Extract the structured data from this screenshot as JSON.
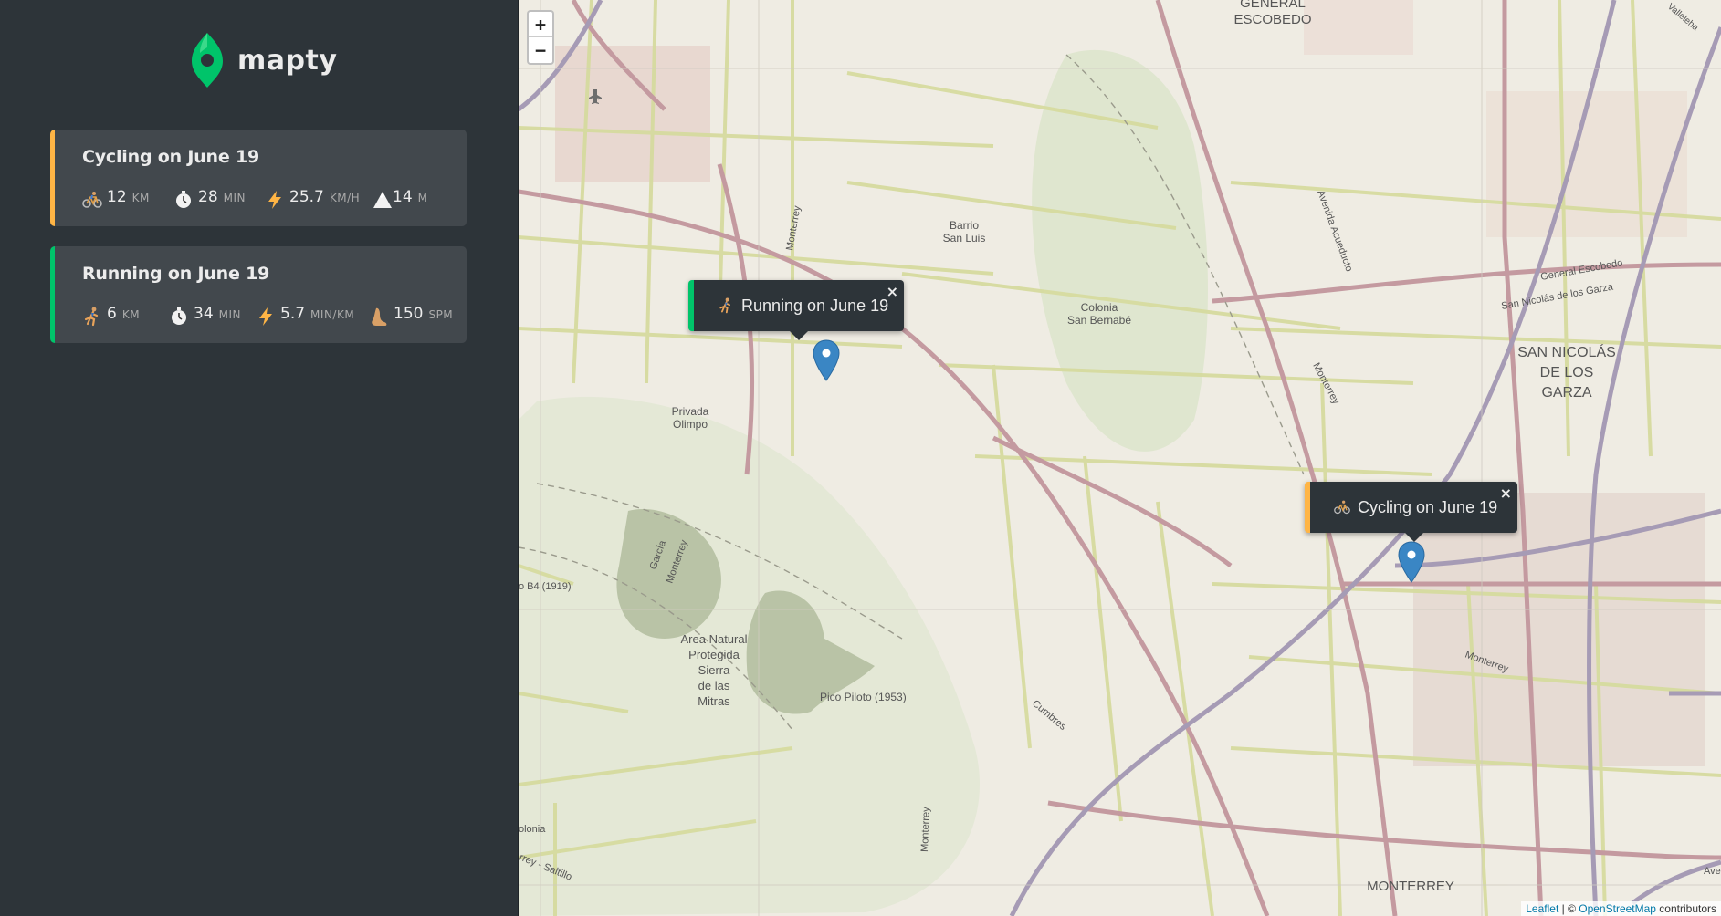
{
  "brand": {
    "name": "mapty"
  },
  "workouts": [
    {
      "type": "cycling",
      "title": "Cycling on June 19",
      "stats": [
        {
          "icon": "bicycle-icon",
          "value": "12",
          "unit": "km"
        },
        {
          "icon": "stopwatch-icon",
          "value": "28",
          "unit": "min"
        },
        {
          "icon": "lightning-icon",
          "value": "25.7",
          "unit": "km/h"
        },
        {
          "icon": "mountain-icon",
          "value": "14",
          "unit": "m"
        }
      ]
    },
    {
      "type": "running",
      "title": "Running on June 19",
      "stats": [
        {
          "icon": "runner-icon",
          "value": "6",
          "unit": "km"
        },
        {
          "icon": "stopwatch-icon",
          "value": "34",
          "unit": "min"
        },
        {
          "icon": "lightning-icon",
          "value": "5.7",
          "unit": "min/km"
        },
        {
          "icon": "footprint-icon",
          "value": "150",
          "unit": "spm"
        }
      ]
    }
  ],
  "map": {
    "zoom_in": "+",
    "zoom_out": "−",
    "popups": [
      {
        "type": "running",
        "text": "Running on June 19",
        "close": "×"
      },
      {
        "type": "cycling",
        "text": "Cycling on June 19",
        "close": "×"
      }
    ],
    "labels": {
      "general_escobedo_1": "GENERAL",
      "general_escobedo_2": "ESCOBEDO",
      "san_nicolas_1": "SAN NICOLÁS",
      "san_nicolas_2": "DE LOS",
      "san_nicolas_3": "GARZA",
      "monterrey_city": "MONTERREY",
      "barrio_1": "Barrio",
      "barrio_2": "San Luis",
      "colonia_1": "Colonia",
      "colonia_2": "San Bernabé",
      "privada_1": "Privada",
      "privada_2": "Olimpo",
      "area_1": "Area Natural",
      "area_2": "Protegida",
      "area_3": "Sierra",
      "area_4": "de las",
      "area_5": "Mitras",
      "pico": "Pico Piloto (1953)",
      "b4": "o B4 (1919)",
      "garcia_1": "García",
      "garcia_2": "Monterrey",
      "road_monterrey_1": "Monterrey",
      "road_monterrey_2": "Monterrey",
      "road_monterrey_3": "Monterrey",
      "road_monterrey_4": "Monterrey",
      "road_acueducto": "Avenida Acueducto",
      "road_gral_escobedo": "General Escobedo",
      "road_san_nicolas": "San Nicolás de los Garza",
      "road_cumbres": "Cumbres",
      "road_saltillo": "rrey - Saltillo",
      "colonia_left": "olonia",
      "ave_right": "Ave",
      "top_right_road": "Valleleha"
    },
    "attribution": {
      "leaflet": "Leaflet",
      "separator": " | © ",
      "osm": "OpenStreetMap",
      "suffix": " contributors"
    }
  },
  "colors": {
    "sidebar_bg": "#2d3439",
    "card_bg": "#42484d",
    "cycling_accent": "#ffb545",
    "running_accent": "#00c46a",
    "marker": "#3a86c4"
  }
}
